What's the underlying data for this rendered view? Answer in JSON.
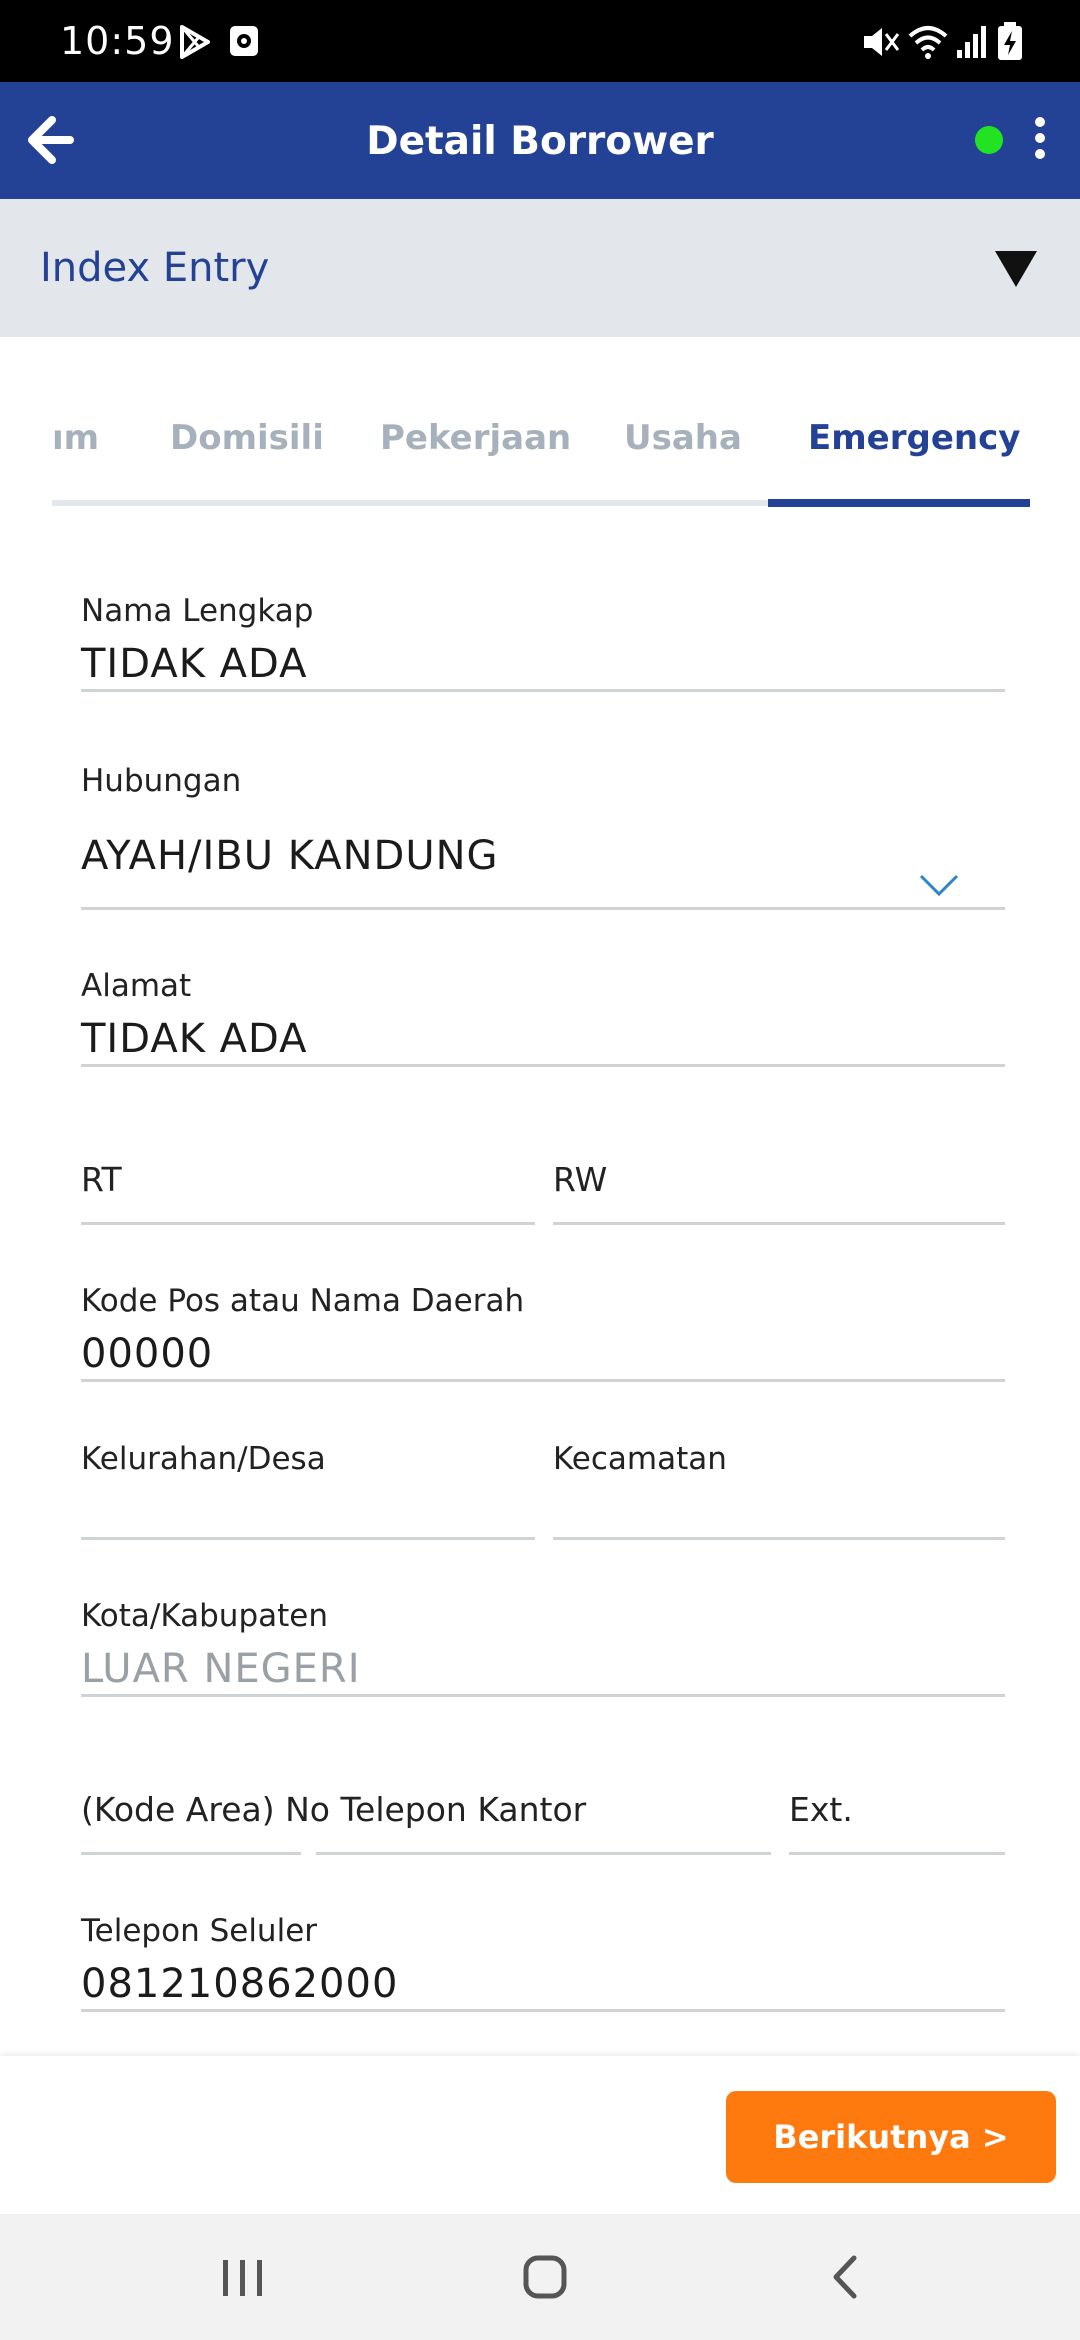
{
  "status_bar": {
    "time": "10:59"
  },
  "app_bar": {
    "title": "Detail Borrower",
    "online_color": "#22e322",
    "bar_color": "#244295"
  },
  "index_entry": {
    "title": "Index Entry"
  },
  "tabs": [
    {
      "label": "ım",
      "active": false
    },
    {
      "label": "Domisili",
      "active": false
    },
    {
      "label": "Pekerjaan",
      "active": false
    },
    {
      "label": "Usaha",
      "active": false
    },
    {
      "label": "Emergency",
      "active": true
    }
  ],
  "form": {
    "nama_lengkap": {
      "label": "Nama Lengkap",
      "value": "TIDAK ADA"
    },
    "hubungan": {
      "label": "Hubungan",
      "value": "AYAH/IBU KANDUNG"
    },
    "alamat": {
      "label": "Alamat",
      "value": "TIDAK ADA"
    },
    "rt": {
      "label": "RT",
      "value": ""
    },
    "rw": {
      "label": "RW",
      "value": ""
    },
    "kode_pos": {
      "label": "Kode Pos atau Nama Daerah",
      "value": "00000"
    },
    "kelurahan": {
      "label": "Kelurahan/Desa",
      "value": ""
    },
    "kecamatan": {
      "label": "Kecamatan",
      "value": ""
    },
    "kota": {
      "label": "Kota/Kabupaten",
      "value": "LUAR NEGERI"
    },
    "telepon_kantor": {
      "label": "(Kode Area) No Telepon Kantor",
      "value": ""
    },
    "ext": {
      "label": "Ext.",
      "value": ""
    },
    "telepon_seluler": {
      "label": "Telepon Seluler",
      "value": "081210862000"
    }
  },
  "actions": {
    "next_label": "Berikutnya >",
    "next_color": "#ff7a0e"
  },
  "icons": {
    "back": "arrow-left-icon",
    "more": "more-vertical-icon",
    "toggle": "triangle-down-icon",
    "dropdown": "chevron-down-icon"
  }
}
